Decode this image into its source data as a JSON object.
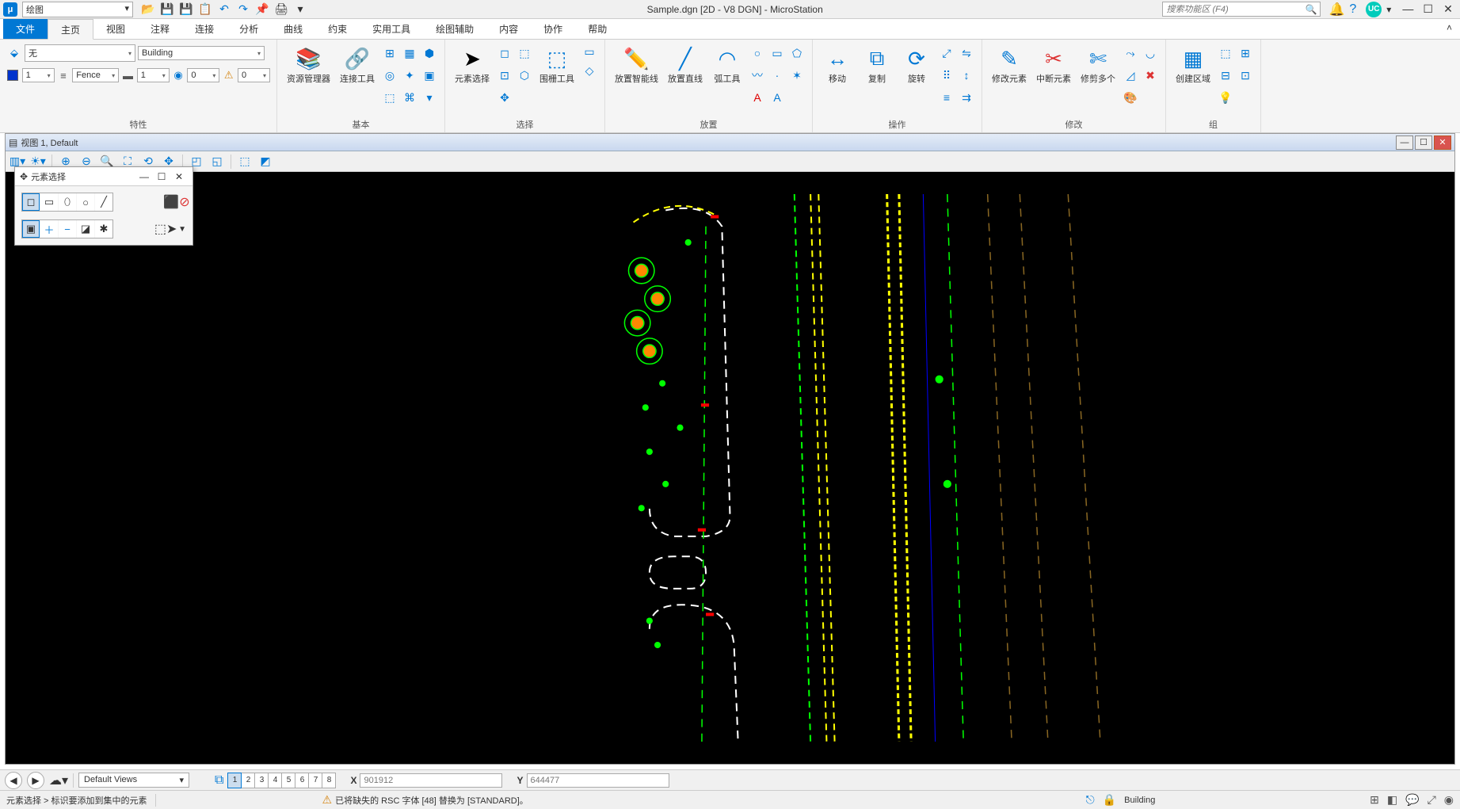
{
  "qat": {
    "combo": "绘图"
  },
  "title": "Sample.dgn [2D - V8 DGN] - MicroStation",
  "search_placeholder": "搜索功能区 (F4)",
  "user_badge": "UC",
  "ribbon_tabs": {
    "file": "文件",
    "home": "主页",
    "rest": [
      "视图",
      "注释",
      "连接",
      "分析",
      "曲线",
      "约束",
      "实用工具",
      "绘图辅助",
      "内容",
      "协作",
      "帮助"
    ]
  },
  "attributes": {
    "level_none": "无",
    "template": "Building",
    "color_value": "1",
    "fence_label": "Fence",
    "weight_value": "1",
    "priority_value": "0",
    "transparency_value": "0",
    "group_label": "特性"
  },
  "primary": {
    "explorer": "资源管理器",
    "attach": "连接工具",
    "group_label": "基本"
  },
  "selection": {
    "element_select": "元素选择",
    "fence_tools": "围栅工具",
    "group_label": "选择"
  },
  "placement": {
    "smartline": "放置智能线",
    "line": "放置直线",
    "arc": "弧工具",
    "group_label": "放置"
  },
  "manipulate": {
    "move": "移动",
    "copy": "复制",
    "rotate": "旋转",
    "group_label": "操作"
  },
  "modify": {
    "modify": "修改元素",
    "break": "中断元素",
    "trim": "修剪多个",
    "group_label": "修改"
  },
  "groups": {
    "create_region": "创建区域",
    "group_label": "组"
  },
  "view": {
    "title": "视图 1, Default"
  },
  "palette": {
    "title": "元素选择"
  },
  "coord": {
    "views_combo": "Default Views",
    "pages": [
      "1",
      "2",
      "3",
      "4",
      "5",
      "6",
      "7",
      "8"
    ],
    "x_label": "X",
    "x_value": "901912",
    "y_label": "Y",
    "y_value": "644477"
  },
  "status": {
    "left": "元素选择 > 标识要添加到集中的元素",
    "warn_msg": "已将缺失的 RSC 字体 [48] 替换为 [STANDARD]。",
    "level": "Building"
  }
}
